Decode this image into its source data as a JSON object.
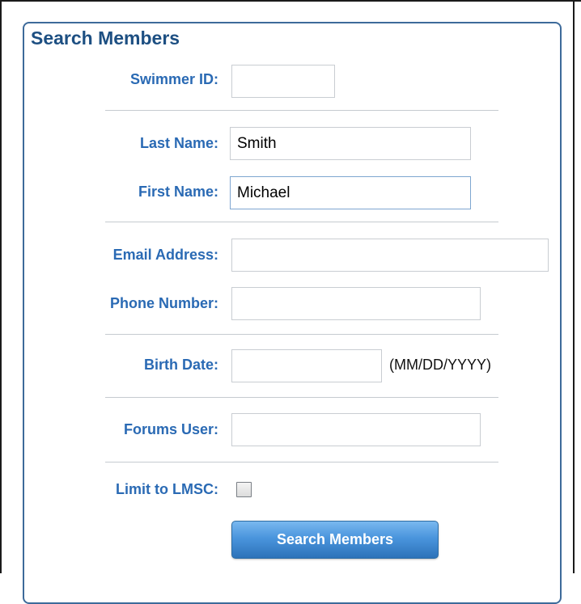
{
  "form": {
    "title": "Search Members",
    "swimmer_id": {
      "label": "Swimmer ID:",
      "value": ""
    },
    "last_name": {
      "label": "Last Name:",
      "value": "Smith"
    },
    "first_name": {
      "label": "First Name:",
      "value": "Michael"
    },
    "email": {
      "label": "Email Address:",
      "value": ""
    },
    "phone": {
      "label": "Phone Number:",
      "value": ""
    },
    "birth_date": {
      "label": "Birth Date:",
      "value": "",
      "format_hint": "(MM/DD/YYYY)"
    },
    "forums_user": {
      "label": "Forums User:",
      "value": ""
    },
    "limit_lmsc": {
      "label": "Limit to LMSC:",
      "checked": false
    },
    "submit_label": "Search Members"
  },
  "colors": {
    "label": "#2a6ab4",
    "title": "#1d4f82",
    "panel_border": "#3d6a9a",
    "button": "#3f86cf"
  }
}
